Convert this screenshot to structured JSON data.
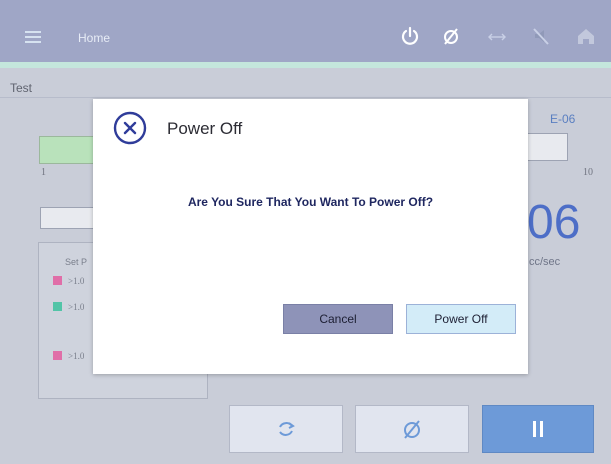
{
  "header": {
    "title": "Home",
    "icons": [
      "menu-icon",
      "power-icon",
      "cancel-icon",
      "swap-arrows-icon",
      "mute-icon",
      "home-icon"
    ]
  },
  "page": {
    "label": "Test",
    "scale_min": "1",
    "scale_max": "10",
    "exp_label": "E-06",
    "big_value": "06",
    "unit": "cc/sec",
    "legend": {
      "title": "Set P",
      "rows": [
        {
          "text": ">1.0",
          "color": "#e06ea8"
        },
        {
          "text": ">1.0",
          "color": "#52c4a7"
        },
        {
          "text": ">1.0",
          "color": "#e06ea8"
        }
      ]
    }
  },
  "bottom_bar": {
    "buttons": [
      "refresh-icon",
      "cancel-icon",
      "pause-icon"
    ]
  },
  "dialog": {
    "title": "Power Off",
    "message": "Are You Sure That You Want To Power Off?",
    "cancel_label": "Cancel",
    "confirm_label": "Power Off",
    "accent_color": "#2f3c9a"
  }
}
